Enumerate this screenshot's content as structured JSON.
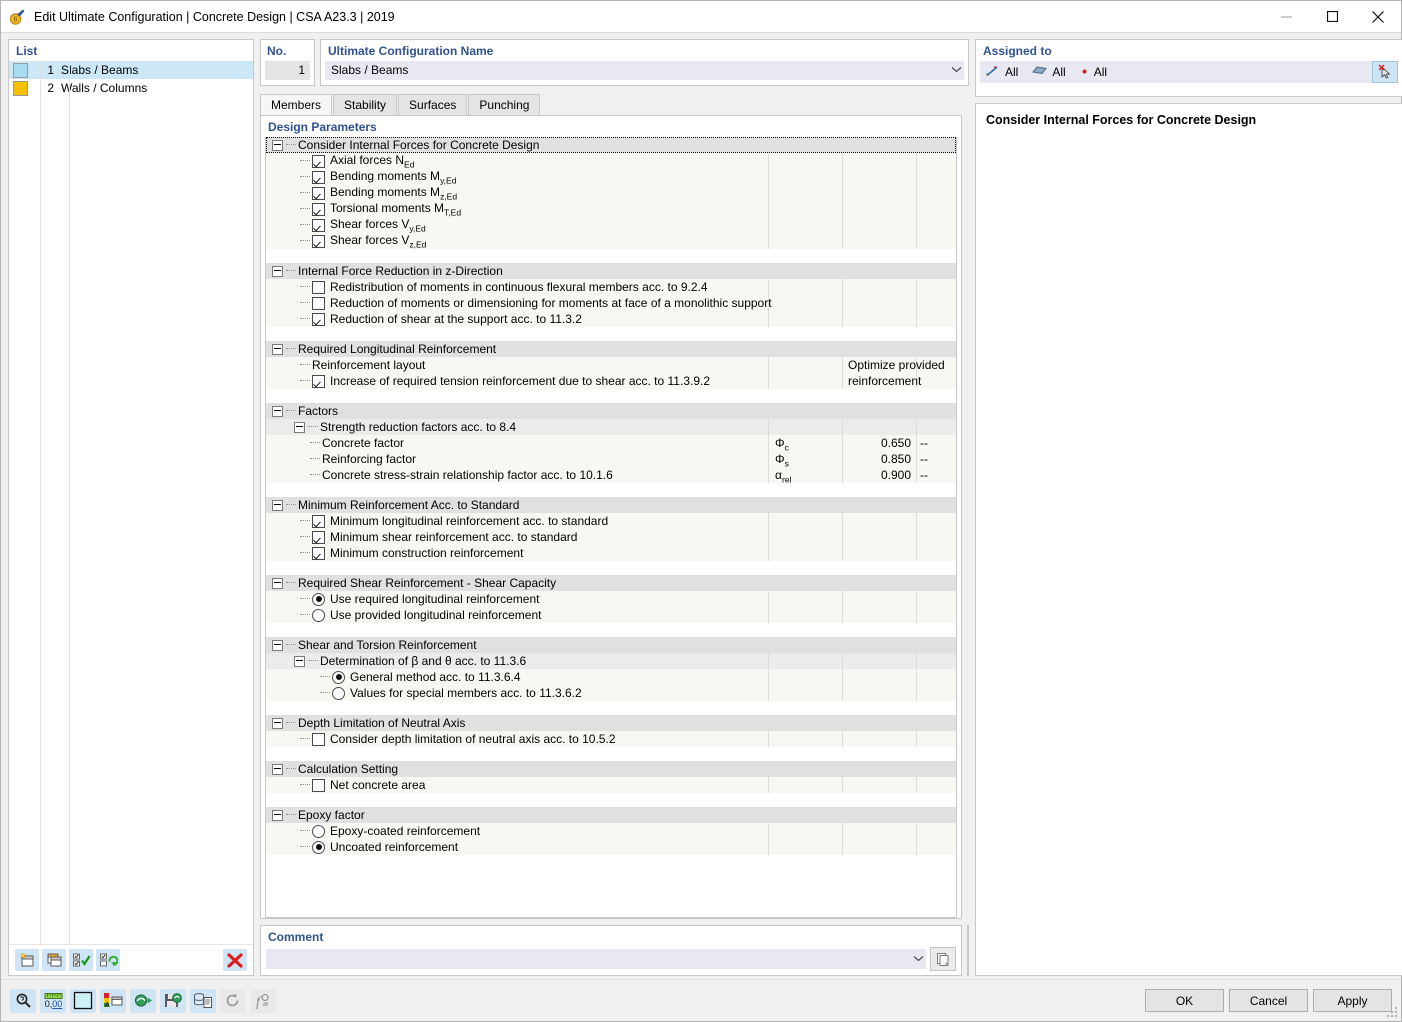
{
  "window": {
    "title": "Edit Ultimate Configuration | Concrete Design | CSA A23.3 | 2019",
    "minimize_label": "–",
    "maximize_label": "☐",
    "close_label": "✕"
  },
  "list_panel": {
    "label": "List",
    "rows": [
      {
        "num": "1",
        "name": "Slabs / Beams",
        "color": "#a8dcf0",
        "selected": true
      },
      {
        "num": "2",
        "name": "Walls / Columns",
        "color": "#f5c000",
        "selected": false
      }
    ],
    "toolbar": [
      {
        "name": "new-configuration-button",
        "icon": "new-window-icon"
      },
      {
        "name": "copy-configuration-button",
        "icon": "copy-window-icon"
      },
      {
        "name": "select-all-button",
        "icon": "checklist-check-icon"
      },
      {
        "name": "invert-selection-button",
        "icon": "checklist-refresh-icon"
      },
      {
        "name": "delete-configuration-button",
        "icon": "red-x-icon"
      }
    ]
  },
  "header": {
    "no_label": "No.",
    "no_value": "1",
    "name_label": "Ultimate Configuration Name",
    "name_value": "Slabs / Beams"
  },
  "tabs": [
    {
      "label": "Members",
      "active": true
    },
    {
      "label": "Stability",
      "active": false
    },
    {
      "label": "Surfaces",
      "active": false
    },
    {
      "label": "Punching",
      "active": false
    }
  ],
  "design_parameters": {
    "label": "Design Parameters",
    "tree": [
      {
        "type": "group",
        "label": "Consider Internal Forces for Concrete Design",
        "dotted": true
      },
      {
        "type": "check",
        "label": "Axial forces N",
        "sub": "Ed",
        "checked": true
      },
      {
        "type": "check",
        "label": "Bending moments M",
        "sub": "y,Ed",
        "checked": true
      },
      {
        "type": "check",
        "label": "Bending moments M",
        "sub": "z,Ed",
        "checked": true
      },
      {
        "type": "check",
        "label": "Torsional moments M",
        "sub": "T,Ed",
        "checked": true
      },
      {
        "type": "check",
        "label": "Shear forces V",
        "sub": "y,Ed",
        "checked": true
      },
      {
        "type": "check",
        "label": "Shear forces V",
        "sub": "z,Ed",
        "checked": true
      },
      {
        "type": "blank"
      },
      {
        "type": "group",
        "label": "Internal Force Reduction in z-Direction"
      },
      {
        "type": "check",
        "label": "Redistribution of moments in continuous flexural members acc. to 9.2.4",
        "checked": false
      },
      {
        "type": "check",
        "label": "Reduction of moments or dimensioning for moments at face of a monolithic support",
        "checked": false
      },
      {
        "type": "check",
        "label": "Reduction of shear at the support acc. to 11.3.2",
        "checked": true
      },
      {
        "type": "blank"
      },
      {
        "type": "group",
        "label": "Required Longitudinal Reinforcement"
      },
      {
        "type": "text",
        "label": "Reinforcement layout",
        "value": "Optimize provided reinforcement"
      },
      {
        "type": "check",
        "label": "Increase of required tension reinforcement due to shear acc. to 11.3.9.2",
        "checked": true
      },
      {
        "type": "blank"
      },
      {
        "type": "group",
        "label": "Factors"
      },
      {
        "type": "subgroup",
        "label": "Strength reduction factors acc. to 8.4"
      },
      {
        "type": "value",
        "label": "Concrete factor",
        "symbol": "Φ",
        "symbol_sub": "c",
        "value": "0.650",
        "unit": "--"
      },
      {
        "type": "value",
        "label": "Reinforcing factor",
        "symbol": "Φ",
        "symbol_sub": "s",
        "value": "0.850",
        "unit": "--"
      },
      {
        "type": "value",
        "label": "Concrete stress-strain relationship factor acc. to 10.1.6",
        "symbol": "α",
        "symbol_sub": "rel",
        "value": "0.900",
        "unit": "--"
      },
      {
        "type": "blank"
      },
      {
        "type": "group",
        "label": "Minimum Reinforcement Acc. to Standard"
      },
      {
        "type": "check",
        "label": "Minimum longitudinal reinforcement acc. to standard",
        "checked": true
      },
      {
        "type": "check",
        "label": "Minimum shear reinforcement acc. to standard",
        "checked": true
      },
      {
        "type": "check",
        "label": "Minimum construction reinforcement",
        "checked": true
      },
      {
        "type": "blank"
      },
      {
        "type": "group",
        "label": "Required Shear Reinforcement - Shear Capacity"
      },
      {
        "type": "radio",
        "label": "Use required longitudinal reinforcement",
        "checked": true
      },
      {
        "type": "radio",
        "label": "Use provided longitudinal reinforcement",
        "checked": false
      },
      {
        "type": "blank"
      },
      {
        "type": "group",
        "label": "Shear and Torsion Reinforcement"
      },
      {
        "type": "subgroup",
        "label": "Determination of β and θ acc. to 11.3.6"
      },
      {
        "type": "radio",
        "indent": 1,
        "label": "General method acc. to 11.3.6.4",
        "checked": true
      },
      {
        "type": "radio",
        "indent": 1,
        "label": "Values for special members acc. to 11.3.6.2",
        "checked": false
      },
      {
        "type": "blank"
      },
      {
        "type": "group",
        "label": "Depth Limitation of Neutral Axis"
      },
      {
        "type": "check",
        "label": "Consider depth limitation of neutral axis acc. to 10.5.2",
        "checked": false
      },
      {
        "type": "blank"
      },
      {
        "type": "group",
        "label": "Calculation Setting"
      },
      {
        "type": "check",
        "label": "Net concrete area",
        "checked": false
      },
      {
        "type": "blank"
      },
      {
        "type": "group",
        "label": "Epoxy factor"
      },
      {
        "type": "radio",
        "label": "Epoxy-coated reinforcement",
        "checked": false
      },
      {
        "type": "radio",
        "label": "Uncoated reinforcement",
        "checked": true
      },
      {
        "type": "blank"
      }
    ]
  },
  "comment": {
    "label": "Comment",
    "value": "",
    "placeholder": "",
    "copy_button": "copy-icon"
  },
  "assigned_to": {
    "label": "Assigned to",
    "items": [
      {
        "icon": "member-icon",
        "text": "All"
      },
      {
        "icon": "surface-icon",
        "text": "All"
      },
      {
        "icon": "node-icon",
        "text": "All"
      }
    ],
    "button": "deselect-pick-icon"
  },
  "info_panel": {
    "title": "Consider Internal Forces for Concrete Design"
  },
  "bottom_toolbar": [
    {
      "name": "zoom-search-button",
      "icon": "magnifier-icon",
      "enabled": true
    },
    {
      "name": "units-button",
      "icon": "ruler-number-icon",
      "enabled": true
    },
    {
      "name": "color-button",
      "icon": "color-swatch-icon",
      "enabled": true
    },
    {
      "name": "legend-button",
      "icon": "legend-window-icon",
      "enabled": true
    },
    {
      "name": "import-button",
      "icon": "import-green-icon",
      "enabled": true
    },
    {
      "name": "export-button",
      "icon": "save-green-icon",
      "enabled": true
    },
    {
      "name": "database-button",
      "icon": "database-doc-icon",
      "enabled": true
    },
    {
      "name": "reset-button",
      "icon": "undo-circle-icon",
      "enabled": false
    },
    {
      "name": "formula-button",
      "icon": "function-icon",
      "enabled": false
    }
  ],
  "dialog_buttons": [
    {
      "label": "OK",
      "name": "ok-button"
    },
    {
      "label": "Cancel",
      "name": "cancel-button"
    },
    {
      "label": "Apply",
      "name": "apply-button"
    }
  ],
  "colors": {
    "accent_label": "#31538f",
    "selection": "#cce8f7",
    "field": "#e8e8f2",
    "group_row": "#e0e0e0",
    "sub_row": "#ebebeb",
    "item_row": "#f8f8f3"
  }
}
